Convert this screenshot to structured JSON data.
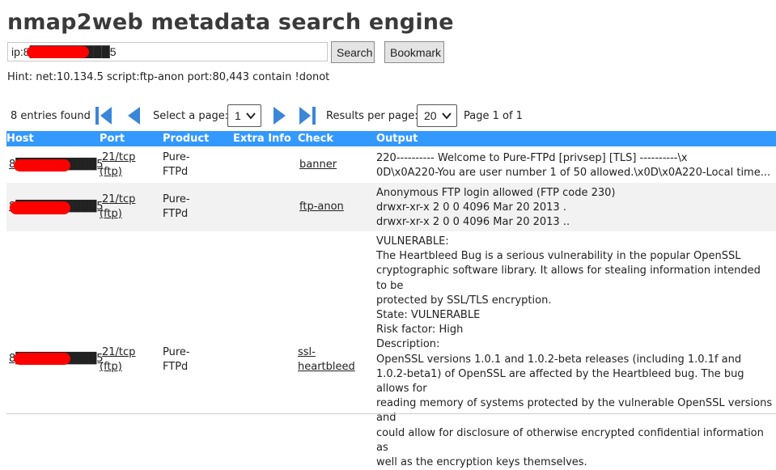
{
  "app": {
    "title": "nmap2web metadata search engine"
  },
  "search": {
    "value": "ip:8██████████5",
    "search_label": "Search",
    "bookmark_label": "Bookmark"
  },
  "hint": "Hint: net:10.134.5 script:ftp-anon port:80,443 contain !donot",
  "pager": {
    "entries_found": "8 entries found",
    "select_page_label": "Select a page:",
    "current_page": "1",
    "results_per_page_label": "Results per page:",
    "per_page": "20",
    "page_status": "Page 1 of 1"
  },
  "table": {
    "columns": [
      "Host",
      "Port",
      "Product",
      "Extra Info",
      "Check",
      "Output"
    ],
    "rows": [
      {
        "host": "8██████████5",
        "port_line1": "21/tcp",
        "port_line2": "(ftp)",
        "product_line1": "Pure-",
        "product_line2": "FTPd",
        "extra": "",
        "check_line1": "banner",
        "check_line2": "",
        "output": [
          "220---------- Welcome to Pure-FTPd [privsep] [TLS] ----------\\x",
          "0D\\x0A220-You are user number 1 of 50 allowed.\\x0D\\x0A220-Local time..."
        ]
      },
      {
        "host": "8██████████5",
        "port_line1": "21/tcp",
        "port_line2": "(ftp)",
        "product_line1": "Pure-",
        "product_line2": "FTPd",
        "extra": "",
        "check_line1": "ftp-anon",
        "check_line2": "",
        "output": [
          "Anonymous FTP login allowed (FTP code 230)",
          "drwxr-xr-x 2 0 0 4096 Mar 20 2013 .",
          "drwxr-xr-x 2 0 0 4096 Mar 20 2013 .."
        ]
      },
      {
        "host": "8██████████5",
        "port_line1": "21/tcp",
        "port_line2": "(ftp)",
        "product_line1": "Pure-",
        "product_line2": "FTPd",
        "extra": "",
        "check_line1": "ssl-",
        "check_line2": "heartbleed",
        "output": [
          "VULNERABLE:",
          "The Heartbleed Bug is a serious vulnerability in the popular OpenSSL",
          "cryptographic software library. It allows for stealing information intended to be",
          "protected by SSL/TLS encryption.",
          "State: VULNERABLE",
          "Risk factor: High",
          "Description:",
          "OpenSSL versions 1.0.1 and 1.0.2-beta releases (including 1.0.1f and",
          "1.0.2-beta1) of OpenSSL are affected by the Heartbleed bug. The bug allows for",
          "reading memory of systems protected by the vulnerable OpenSSL versions and",
          "could allow for disclosure of otherwise encrypted confidential information as",
          "well as the encryption keys themselves."
        ]
      }
    ]
  },
  "colors": {
    "header_bg": "#3399ff",
    "stripe_bg": "#f2f2f2",
    "redaction": "#ff0000",
    "icon_blue": "#3a86d8"
  },
  "icons": [
    "first-page-icon",
    "previous-page-icon",
    "next-page-icon",
    "last-page-icon",
    "chevron-down-icon"
  ]
}
